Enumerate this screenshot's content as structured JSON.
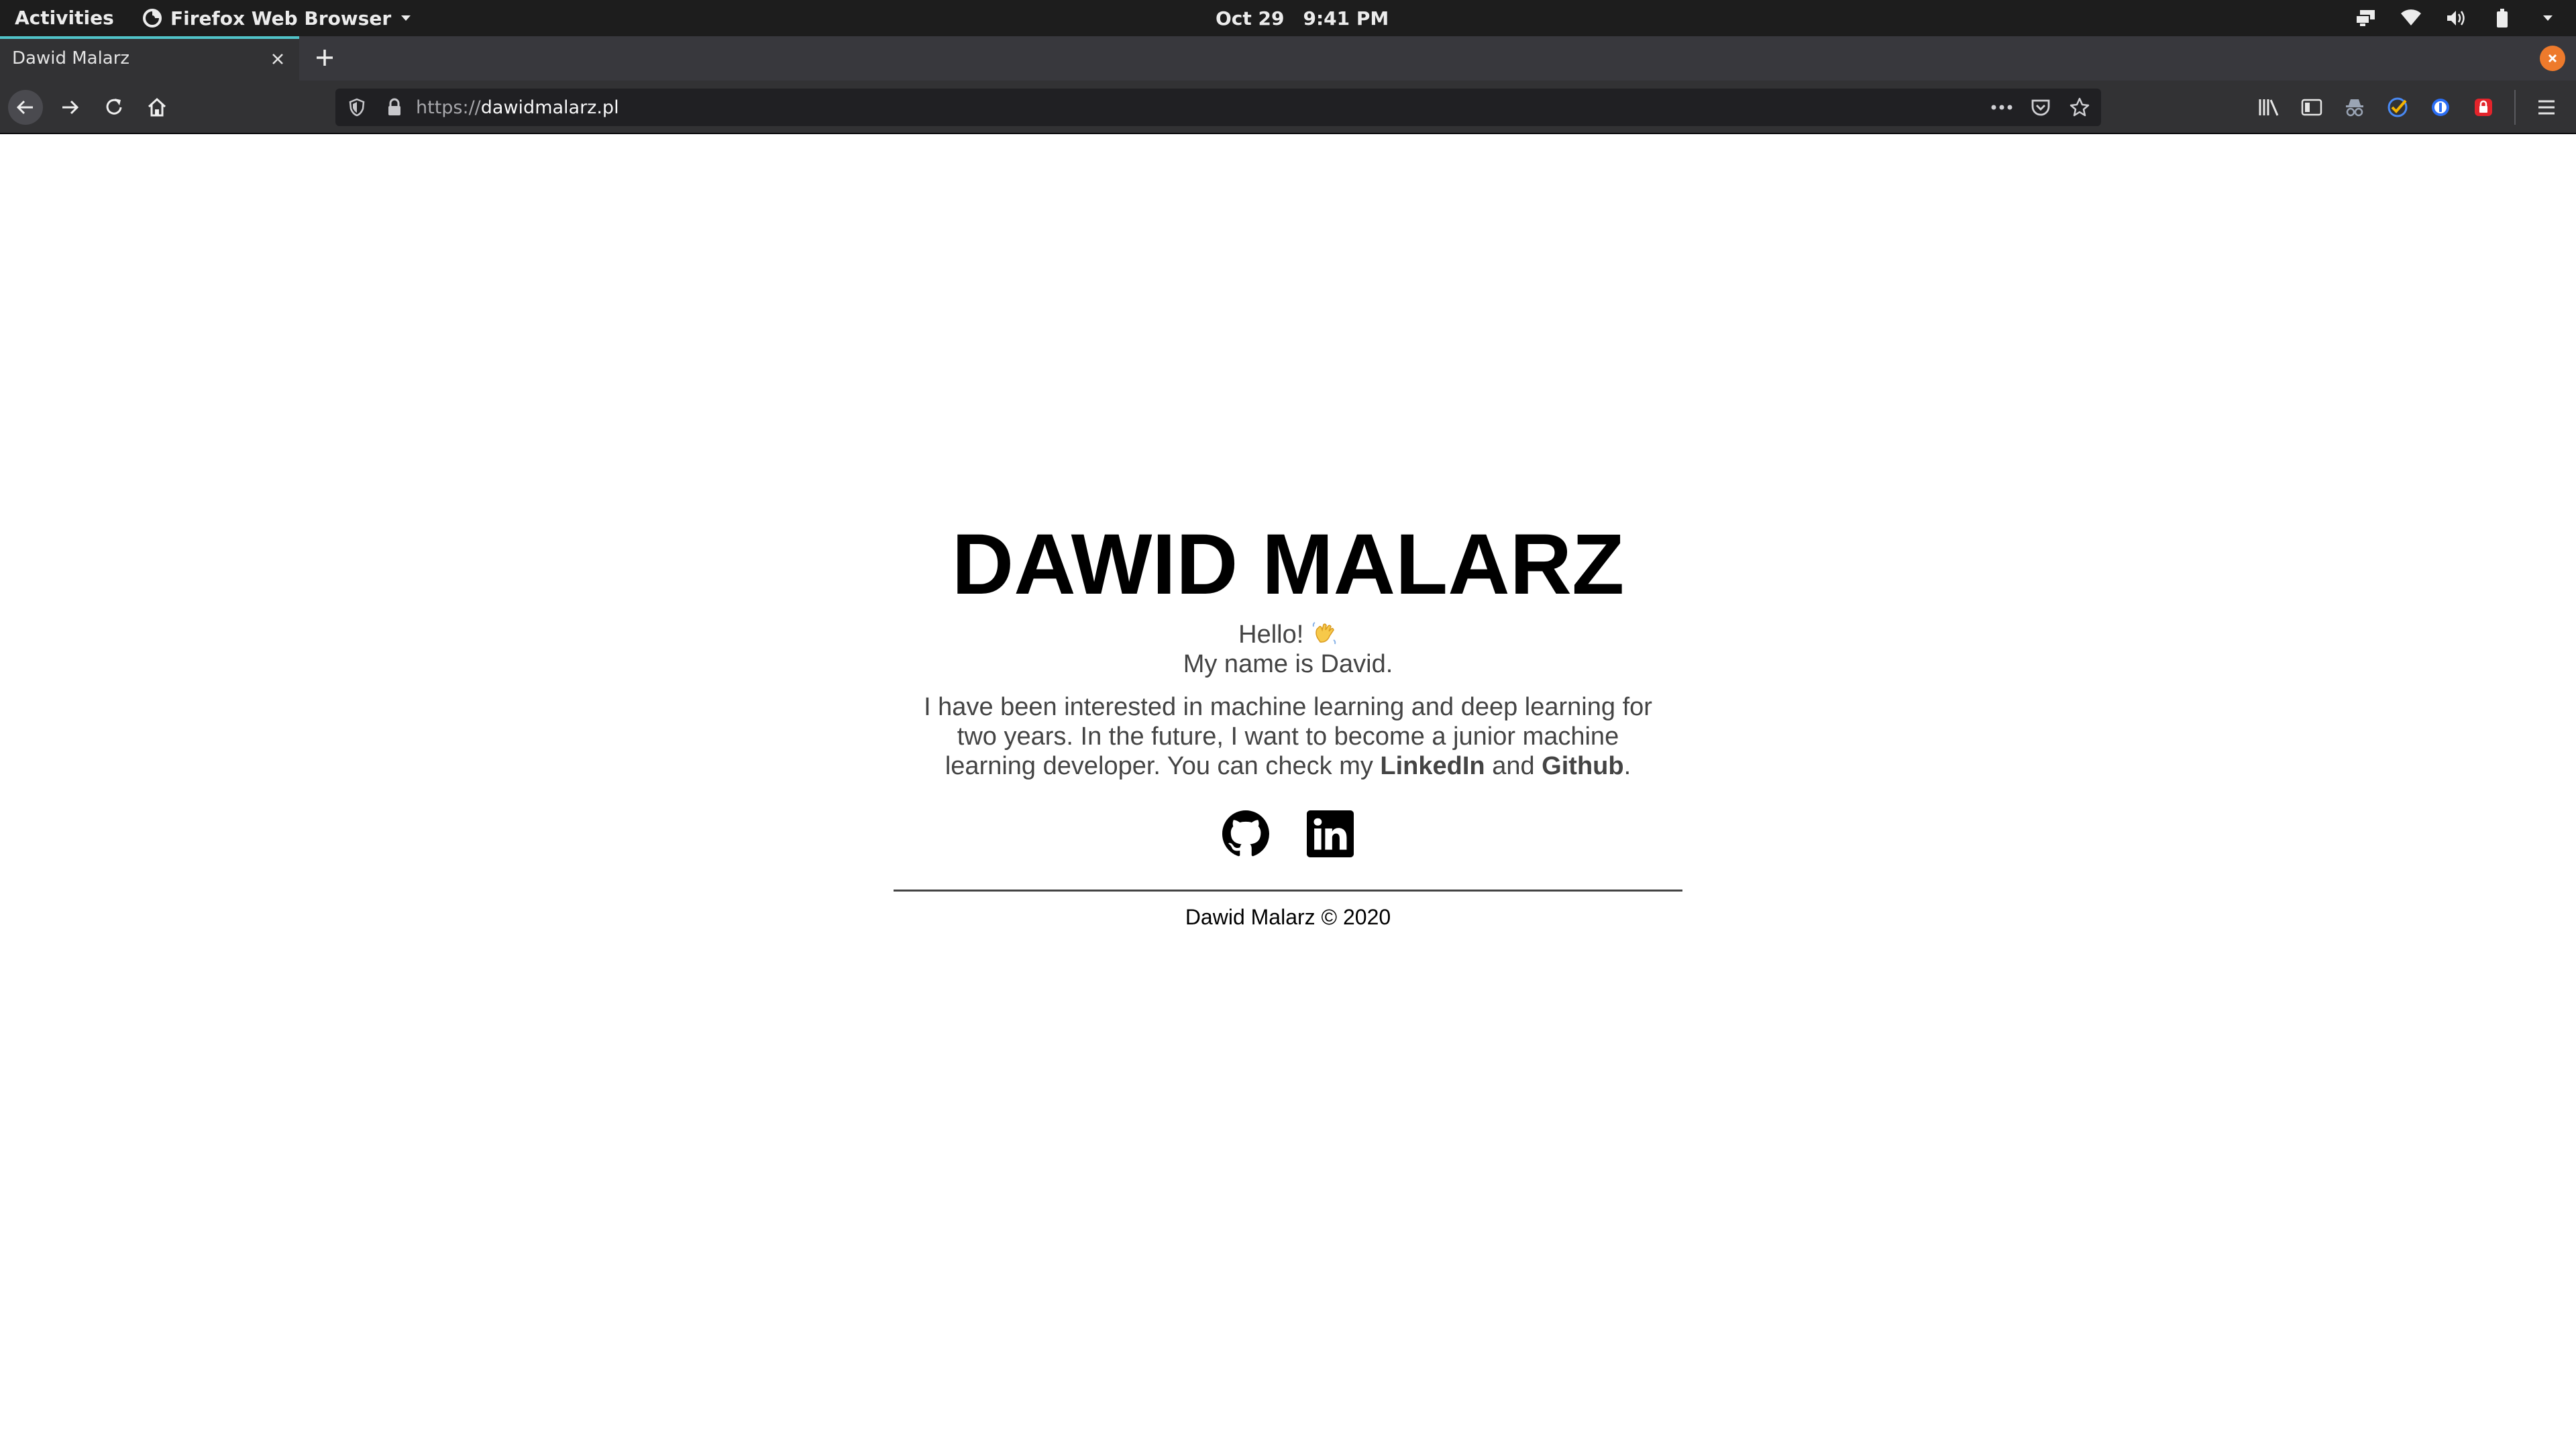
{
  "topbar": {
    "activities": "Activities",
    "app_name": "Firefox Web Browser",
    "date": "Oct 29",
    "time": "9:41 PM",
    "tray_icons": [
      "display-icon",
      "wifi-icon",
      "volume-icon",
      "battery-icon",
      "chevron-down-icon"
    ]
  },
  "browser": {
    "tab_title": "Dawid Malarz",
    "url_scheme": "https://",
    "url_host": "dawidmalarz.pl",
    "accent_color": "#51c4c9",
    "close_button_color": "#ee7a2c"
  },
  "page": {
    "heading": "DAWID MALARZ",
    "hello": "Hello!",
    "my_name": "My name is David.",
    "bio_part1": "I have been interested in machine learning and deep learning for two years. In the future, I want to become a junior machine learning developer. You can check my ",
    "linkedin_label": "LinkedIn",
    "bio_part2": " and ",
    "github_label": "Github",
    "bio_part3": ".",
    "footer": "Dawid Malarz © 2020"
  }
}
